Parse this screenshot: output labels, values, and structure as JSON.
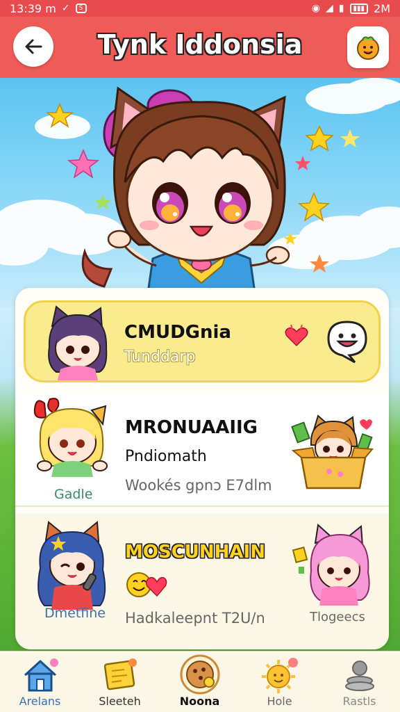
{
  "status_bar": {
    "time": "13:39 m",
    "right_time": "2M"
  },
  "app": {
    "title": "Tynk Iddonsia"
  },
  "list": [
    {
      "title": "CMUDGnia",
      "subtitle": "Tunddarp",
      "meta": "",
      "label": ""
    },
    {
      "title": "MRONUAAIIG",
      "subtitle": "Pndiomath",
      "meta": "Wookés gpnɔ E7dlm",
      "label": "Gadle"
    },
    {
      "title": "MOSCUNHAIN",
      "subtitle": "",
      "meta": "Hadkaleepnt T2U/n",
      "label": "Dmetfine",
      "right_label": "Tlogeecs"
    }
  ],
  "nav": [
    {
      "label": "Arelans",
      "icon": "home-icon"
    },
    {
      "label": "Sleeteh",
      "icon": "notes-icon"
    },
    {
      "label": "Noona",
      "icon": "cookie-icon",
      "active": true
    },
    {
      "label": "Hole",
      "icon": "sun-icon"
    },
    {
      "label": "Rastls",
      "icon": "stack-icon"
    }
  ],
  "colors": {
    "appbar": "#ef5c58",
    "highlight": "#fbeb8f",
    "nav_text": "#3b6fb0"
  }
}
